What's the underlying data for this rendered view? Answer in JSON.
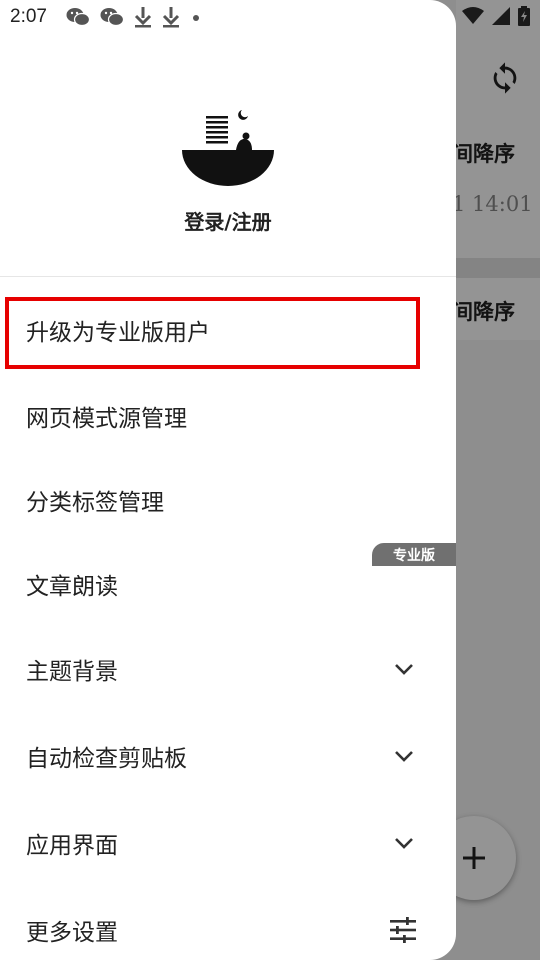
{
  "status_bar": {
    "time": "2:07"
  },
  "drawer": {
    "login_label": "登录/注册",
    "menu": [
      {
        "label": "升级为专业版用户"
      },
      {
        "label": "网页模式源管理"
      },
      {
        "label": "分类标签管理"
      },
      {
        "label": "文章朗读",
        "badge": "专业版"
      },
      {
        "label": "主题背景"
      },
      {
        "label": "自动检查剪贴板"
      },
      {
        "label": "应用界面"
      },
      {
        "label": "更多设置"
      }
    ]
  },
  "background": {
    "sort_label_1": "间降序",
    "time_text": "1 14:01",
    "sort_label_2": "间降序"
  },
  "colors": {
    "highlight": "#e60000",
    "badge_bg": "#707070"
  },
  "icons": [
    "wechat-icon",
    "download-icon",
    "wifi-icon",
    "signal-icon",
    "battery-icon",
    "sync-icon",
    "chevron-down-icon",
    "tune-icon",
    "plus-icon"
  ]
}
